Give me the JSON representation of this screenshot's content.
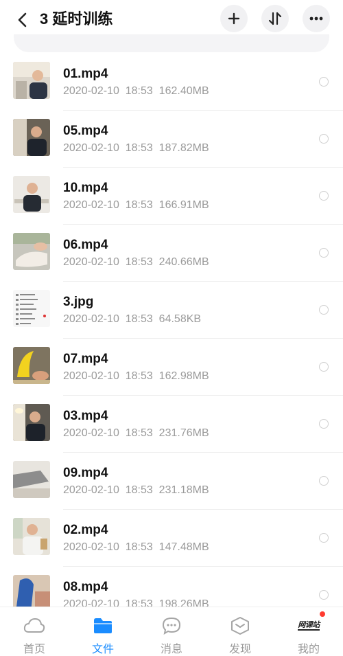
{
  "header": {
    "title": "3 延时训练"
  },
  "files": [
    {
      "name": "01.mp4",
      "date": "2020-02-10",
      "time": "18:53",
      "size": "162.40MB",
      "thumb": "video-thumb-man-office"
    },
    {
      "name": "05.mp4",
      "date": "2020-02-10",
      "time": "18:53",
      "size": "187.82MB",
      "thumb": "video-thumb-man-dark"
    },
    {
      "name": "10.mp4",
      "date": "2020-02-10",
      "time": "18:53",
      "size": "166.91MB",
      "thumb": "video-thumb-man-light"
    },
    {
      "name": "06.mp4",
      "date": "2020-02-10",
      "time": "18:53",
      "size": "240.66MB",
      "thumb": "video-thumb-body"
    },
    {
      "name": "3.jpg",
      "date": "2020-02-10",
      "time": "18:53",
      "size": "64.58KB",
      "thumb": "image-thumb-list"
    },
    {
      "name": "07.mp4",
      "date": "2020-02-10",
      "time": "18:53",
      "size": "162.98MB",
      "thumb": "video-thumb-banana"
    },
    {
      "name": "03.mp4",
      "date": "2020-02-10",
      "time": "18:53",
      "size": "231.76MB",
      "thumb": "video-thumb-man-lamp"
    },
    {
      "name": "09.mp4",
      "date": "2020-02-10",
      "time": "18:53",
      "size": "231.18MB",
      "thumb": "video-thumb-gray"
    },
    {
      "name": "02.mp4",
      "date": "2020-02-10",
      "time": "18:53",
      "size": "147.48MB",
      "thumb": "video-thumb-man-white"
    },
    {
      "name": "08.mp4",
      "date": "2020-02-10",
      "time": "18:53",
      "size": "198.26MB",
      "thumb": "video-thumb-blue"
    }
  ],
  "tabbar": {
    "tabs": [
      {
        "label": "首页",
        "icon": "cloud-icon",
        "active": false
      },
      {
        "label": "文件",
        "icon": "folder-icon",
        "active": true
      },
      {
        "label": "消息",
        "icon": "chat-icon",
        "active": false
      },
      {
        "label": "发现",
        "icon": "discover-icon",
        "active": false
      },
      {
        "label": "我的",
        "icon": "brand-logo",
        "active": false,
        "badge": true
      }
    ],
    "brand_text": "网课站"
  },
  "colors": {
    "accent": "#1a8cff",
    "badge": "#ff3b30",
    "meta_text": "#9a9a9a"
  }
}
